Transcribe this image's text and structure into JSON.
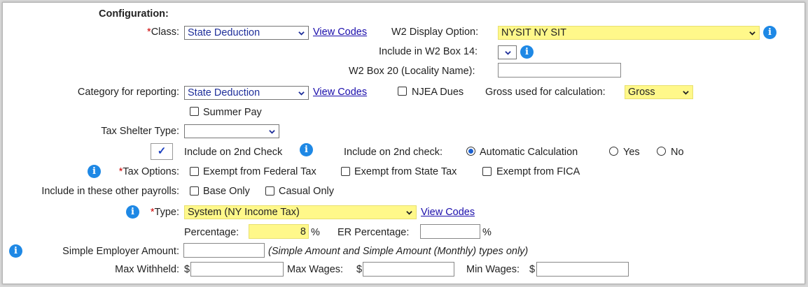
{
  "section_title": "Configuration:",
  "required_mark": "*",
  "class": {
    "label": "Class:",
    "value": "State Deduction",
    "view_codes": "View Codes"
  },
  "w2_display": {
    "label": "W2 Display Option:",
    "value": "NYSIT NY SIT"
  },
  "w2_box14": {
    "label": "Include in W2 Box 14:",
    "value": ""
  },
  "w2_box20": {
    "label": "W2 Box 20 (Locality Name):",
    "value": ""
  },
  "category": {
    "label": "Category for reporting:",
    "value": "State Deduction",
    "view_codes": "View Codes"
  },
  "njea_dues": {
    "label": "NJEA Dues",
    "checked": false
  },
  "gross_used": {
    "label": "Gross used for calculation:",
    "value": "Gross"
  },
  "summer_pay": {
    "label": "Summer Pay",
    "checked": false
  },
  "tax_shelter": {
    "label": "Tax Shelter Type:",
    "value": ""
  },
  "second_check": {
    "check_mark": "✓",
    "label": "Include on 2nd Check",
    "option_label": "Include on 2nd check:",
    "options": [
      "Automatic Calculation",
      "Yes",
      "No"
    ],
    "selected": "Automatic Calculation"
  },
  "tax_options": {
    "label": "Tax Options:",
    "items": [
      "Exempt from Federal Tax",
      "Exempt from State Tax",
      "Exempt from FICA"
    ]
  },
  "other_payrolls": {
    "label": "Include in these other payrolls:",
    "items": [
      "Base Only",
      "Casual Only"
    ]
  },
  "type": {
    "label": "Type:",
    "value": "System (NY Income Tax)",
    "view_codes": "View Codes"
  },
  "percentage": {
    "label": "Percentage:",
    "value": "8",
    "unit": "%"
  },
  "er_percentage": {
    "label": "ER Percentage:",
    "value": "",
    "unit": "%"
  },
  "simple_employer": {
    "label": "Simple Employer Amount:",
    "value": "",
    "note": "(Simple Amount and Simple Amount (Monthly) types only)"
  },
  "max_withheld": {
    "label": "Max Withheld:",
    "currency": "$",
    "value": ""
  },
  "max_wages": {
    "label": "Max Wages:",
    "currency": "$",
    "value": ""
  },
  "min_wages": {
    "label": "Min Wages:",
    "currency": "$",
    "value": ""
  },
  "colors": {
    "highlight": "#fff88a",
    "info": "#1e88e5",
    "link": "#1a0dab",
    "required": "#cc0000"
  }
}
